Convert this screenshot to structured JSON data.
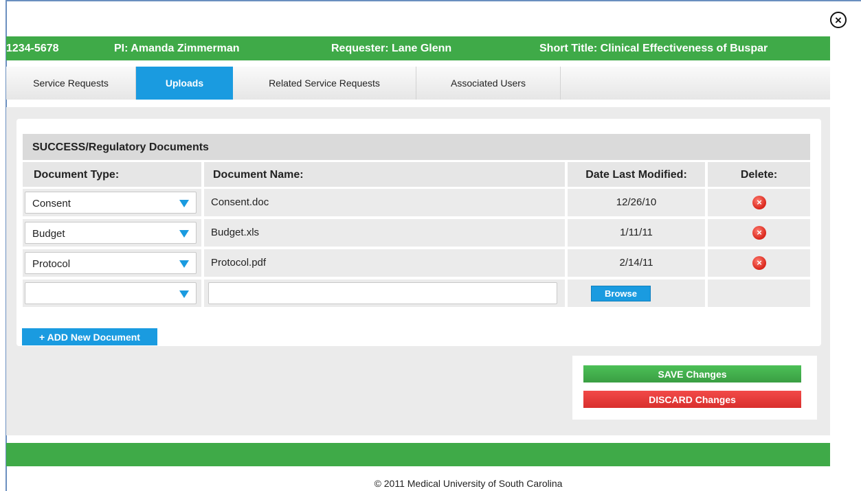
{
  "close_icon": "×",
  "header": {
    "project_id": "1234-5678",
    "pi": "PI: Amanda Zimmerman",
    "requester": "Requester: Lane Glenn",
    "short_title": "Short Title:  Clinical Effectiveness of Buspar"
  },
  "tabs": [
    {
      "label": "Service Requests",
      "active": false
    },
    {
      "label": "Uploads",
      "active": true
    },
    {
      "label": "Related Service Requests",
      "active": false
    },
    {
      "label": "Associated Users",
      "active": false
    }
  ],
  "documents": {
    "section_title": "SUCCESS/Regulatory Documents",
    "columns": {
      "type": "Document Type:",
      "name": "Document Name:",
      "date": "Date Last Modified:",
      "delete": "Delete:"
    },
    "rows": [
      {
        "type": "Consent",
        "name": "Consent.doc",
        "date": "12/26/10"
      },
      {
        "type": "Budget",
        "name": "Budget.xls",
        "date": "1/11/11"
      },
      {
        "type": "Protocol",
        "name": "Protocol.pdf",
        "date": "2/14/11"
      }
    ],
    "new_row": {
      "type": "",
      "name": "",
      "browse_label": "Browse"
    },
    "add_label": "+ ADD New Document",
    "delete_icon": "×"
  },
  "actions": {
    "save_label": "SAVE Changes",
    "discard_label": "DISCARD Changes"
  },
  "colors": {
    "brand_green": "#3faa48",
    "accent_blue": "#1a9be0",
    "danger_red": "#e0312f"
  },
  "footer": {
    "copyright": "© 2011 Medical University of South Carolina"
  }
}
